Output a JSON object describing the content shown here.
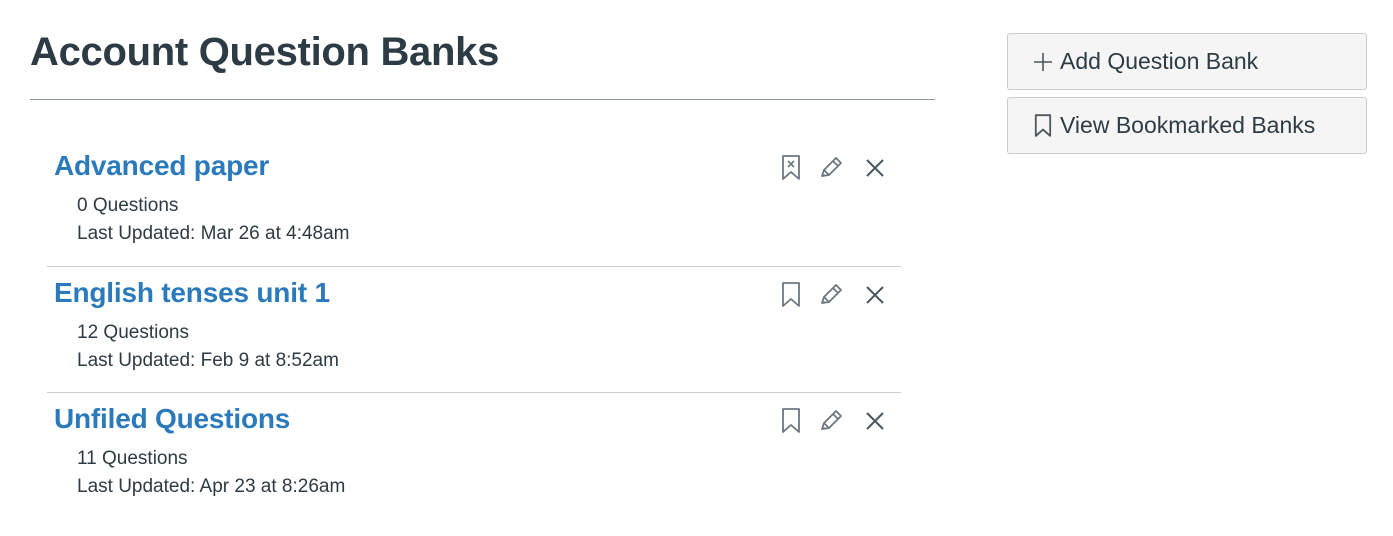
{
  "page": {
    "title": "Account Question Banks"
  },
  "banks": [
    {
      "name": "Advanced paper",
      "count": "0 Questions",
      "updated": "Last Updated: Mar 26 at 4:48am",
      "bookmark_icon": "bookmark-remove-icon"
    },
    {
      "name": "English tenses unit 1",
      "count": "12 Questions",
      "updated": "Last Updated: Feb 9 at 8:52am",
      "bookmark_icon": "bookmark-icon"
    },
    {
      "name": "Unfiled Questions",
      "count": "11 Questions",
      "updated": "Last Updated: Apr 23 at 8:26am",
      "bookmark_icon": "bookmark-icon"
    }
  ],
  "sidebar": {
    "add_label": "Add Question Bank",
    "bookmarked_label": "View Bookmarked Banks"
  },
  "colors": {
    "link": "#2b7abc",
    "text": "#2d3b45",
    "icon": "#6b7780",
    "button_bg": "#f5f5f5",
    "border": "#c7cdd1"
  }
}
